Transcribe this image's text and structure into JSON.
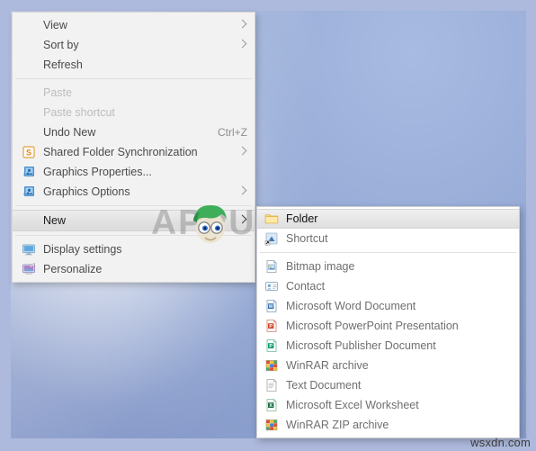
{
  "watermarks": {
    "brand": "APPUALS",
    "site": "wsxdn.com"
  },
  "desktop": {
    "name": "windows-desktop-wallpaper",
    "background_color": "#8fa2ce",
    "frame_color": "#aebadd"
  },
  "context_menu": {
    "name": "desktop-context-menu",
    "items": [
      {
        "label": "View",
        "icon": "none",
        "disabled": false,
        "submenu": true,
        "selected": false,
        "accel": ""
      },
      {
        "label": "Sort by",
        "icon": "none",
        "disabled": false,
        "submenu": true,
        "selected": false,
        "accel": ""
      },
      {
        "label": "Refresh",
        "icon": "none",
        "disabled": false,
        "submenu": false,
        "selected": false,
        "accel": ""
      },
      {
        "separator": true
      },
      {
        "label": "Paste",
        "icon": "none",
        "disabled": true,
        "submenu": false,
        "selected": false,
        "accel": ""
      },
      {
        "label": "Paste shortcut",
        "icon": "none",
        "disabled": true,
        "submenu": false,
        "selected": false,
        "accel": ""
      },
      {
        "label": "Undo New",
        "icon": "none",
        "disabled": false,
        "submenu": false,
        "selected": false,
        "accel": "Ctrl+Z"
      },
      {
        "label": "Shared Folder Synchronization",
        "icon": "shared-folder-sync-icon",
        "disabled": false,
        "submenu": true,
        "selected": false,
        "accel": ""
      },
      {
        "label": "Graphics Properties...",
        "icon": "graphics-properties-icon",
        "disabled": false,
        "submenu": false,
        "selected": false,
        "accel": ""
      },
      {
        "label": "Graphics Options",
        "icon": "graphics-options-icon",
        "disabled": false,
        "submenu": true,
        "selected": false,
        "accel": ""
      },
      {
        "separator": true
      },
      {
        "label": "New",
        "icon": "none",
        "disabled": false,
        "submenu": true,
        "selected": true,
        "accel": ""
      },
      {
        "separator": true
      },
      {
        "label": "Display settings",
        "icon": "display-settings-icon",
        "disabled": false,
        "submenu": false,
        "selected": false,
        "accel": ""
      },
      {
        "label": "Personalize",
        "icon": "personalize-icon",
        "disabled": false,
        "submenu": false,
        "selected": false,
        "accel": ""
      }
    ]
  },
  "new_submenu": {
    "name": "new-item-submenu",
    "items": [
      {
        "label": "Folder",
        "icon": "folder-icon",
        "selected": true
      },
      {
        "label": "Shortcut",
        "icon": "shortcut-icon",
        "selected": false
      },
      {
        "separator": true
      },
      {
        "label": "Bitmap image",
        "icon": "bitmap-icon",
        "selected": false
      },
      {
        "label": "Contact",
        "icon": "contact-icon",
        "selected": false
      },
      {
        "label": "Microsoft Word Document",
        "icon": "word-icon",
        "selected": false
      },
      {
        "label": "Microsoft PowerPoint Presentation",
        "icon": "powerpoint-icon",
        "selected": false
      },
      {
        "label": "Microsoft Publisher Document",
        "icon": "publisher-icon",
        "selected": false
      },
      {
        "label": "WinRAR archive",
        "icon": "winrar-icon",
        "selected": false
      },
      {
        "label": "Text Document",
        "icon": "text-icon",
        "selected": false
      },
      {
        "label": "Microsoft Excel Worksheet",
        "icon": "excel-icon",
        "selected": false
      },
      {
        "label": "WinRAR ZIP archive",
        "icon": "winrar-zip-icon",
        "selected": false
      }
    ]
  },
  "colors": {
    "menu_background": "#f2f2f2",
    "submenu_background": "#ffffff",
    "text": "#4a4a4a",
    "disabled_text": "#bdbdbd",
    "highlight": "#e4e4e4",
    "separator": "#e0e0e0"
  }
}
